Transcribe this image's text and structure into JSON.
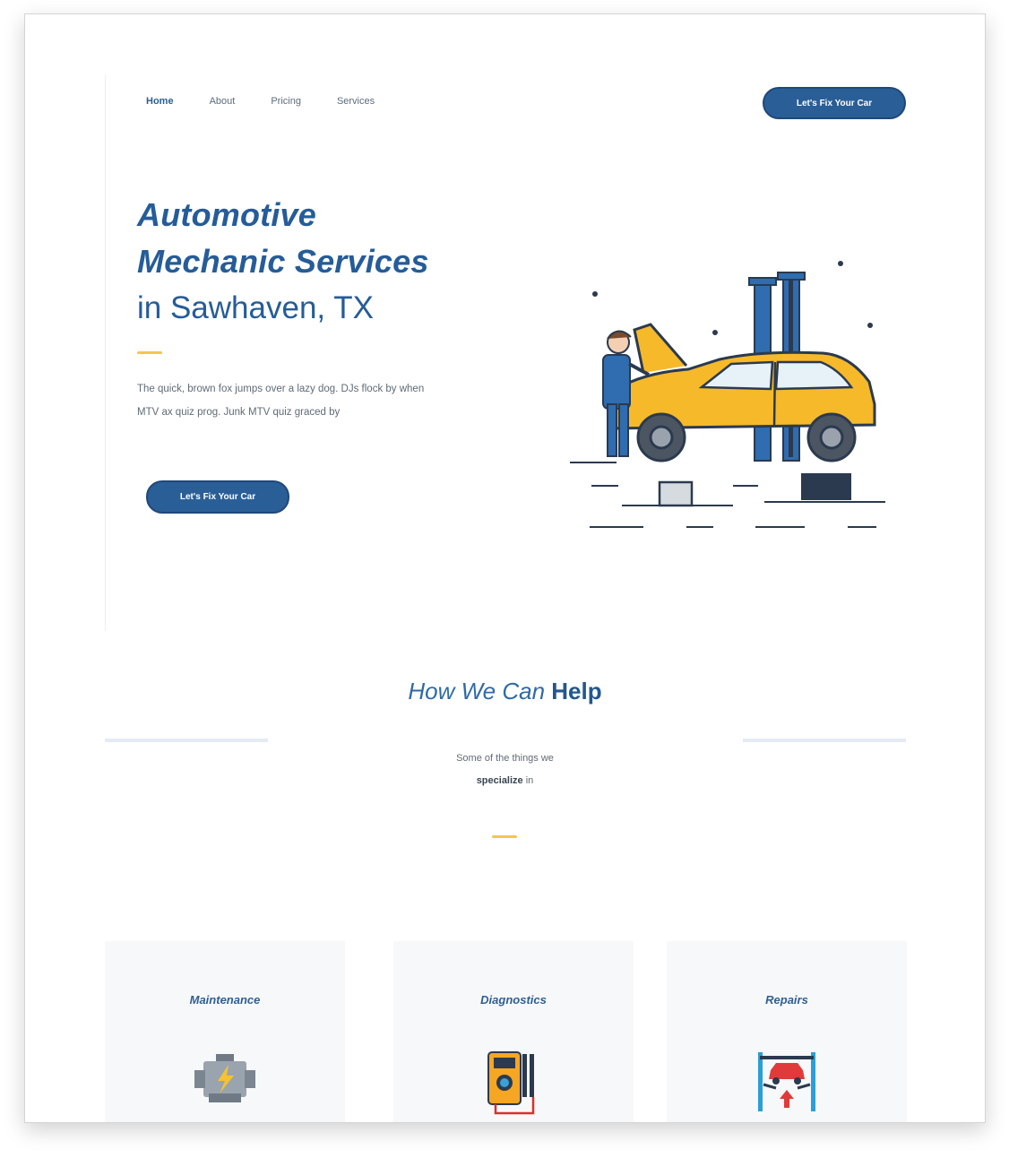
{
  "nav": {
    "items": [
      {
        "label": "Home",
        "active": true
      },
      {
        "label": "About",
        "active": false
      },
      {
        "label": "Pricing",
        "active": false
      },
      {
        "label": "Services",
        "active": false
      }
    ],
    "cta_label": "Let's Fix Your Car"
  },
  "hero": {
    "title_line1": "Automotive",
    "title_line2": "Mechanic Services",
    "title_line3": "in Sawhaven, TX",
    "description": "The quick, brown fox jumps over a lazy dog. DJs flock by when MTV ax quiz prog. Junk MTV quiz graced by",
    "cta_label": "Let's Fix Your Car"
  },
  "help": {
    "title_italic": "How We Can",
    "title_bold": "Help",
    "subtitle_line1": "Some of the things we",
    "subtitle_bold": "specialize",
    "subtitle_tail": "in"
  },
  "cards": [
    {
      "title": "Maintenance",
      "icon": "engine-icon"
    },
    {
      "title": "Diagnostics",
      "icon": "multimeter-icon"
    },
    {
      "title": "Repairs",
      "icon": "car-lift-icon"
    }
  ],
  "colors": {
    "primary": "#2a5e96",
    "accent": "#f5c451",
    "car": "#f6b92a",
    "card_bg": "#f7f8f9"
  }
}
